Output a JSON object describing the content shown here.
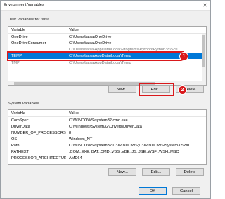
{
  "window": {
    "title": "Environment Variables",
    "close_glyph": "✕"
  },
  "user_section": {
    "label": "User variables for faisa",
    "columns": [
      "Variable",
      "Value"
    ],
    "rows": [
      {
        "variable": "OneDrive",
        "value": "C:\\Users\\faisa\\OneDrive"
      },
      {
        "variable": "OneDriveConsumer",
        "value": "C:\\Users\\faisa\\OneDrive"
      },
      {
        "variable": "",
        "value": "C:\\Users\\faisa\\AppData\\Local\\Programs\\Python\\Python38\\Scri..."
      },
      {
        "variable": "TEMP",
        "value": "C:\\Users\\faisa\\AppData\\Local\\Temp"
      },
      {
        "variable": "TMP",
        "value": "C:\\Users\\faisa\\AppData\\Local\\Temp"
      }
    ],
    "selected_row": "TEMP",
    "buttons": {
      "new": "New...",
      "edit": "Edit...",
      "delete": "Delete"
    }
  },
  "system_section": {
    "label": "System variables",
    "columns": [
      "Variable",
      "Value"
    ],
    "rows": [
      {
        "variable": "ComSpec",
        "value": "C:\\WINDOWS\\system32\\cmd.exe"
      },
      {
        "variable": "DriverData",
        "value": "C:\\Windows\\System32\\Drivers\\DriverData"
      },
      {
        "variable": "NUMBER_OF_PROCESSORS",
        "value": "8"
      },
      {
        "variable": "OS",
        "value": "Windows_NT"
      },
      {
        "variable": "Path",
        "value": "C:\\WINDOWS\\system32;C:\\WINDOWS;C:\\WINDOWS\\System32\\Wb..."
      },
      {
        "variable": "PATHEXT",
        "value": ".COM;.EXE;.BAT;.CMD;.VBS;.VBE;.JS;.JSE;.WSF;.WSH;.MSC"
      },
      {
        "variable": "PROCESSOR_ARCHITECTURE",
        "value": "AMD64"
      }
    ],
    "buttons": {
      "new": "New...",
      "edit": "Edit...",
      "delete": "Delete"
    }
  },
  "footer": {
    "ok": "OK",
    "cancel": "Cancel"
  },
  "annotations": {
    "badge1": "1",
    "badge2": "2",
    "highlight_color": "#d9191c"
  },
  "colors": {
    "selection": "#0078d7"
  }
}
